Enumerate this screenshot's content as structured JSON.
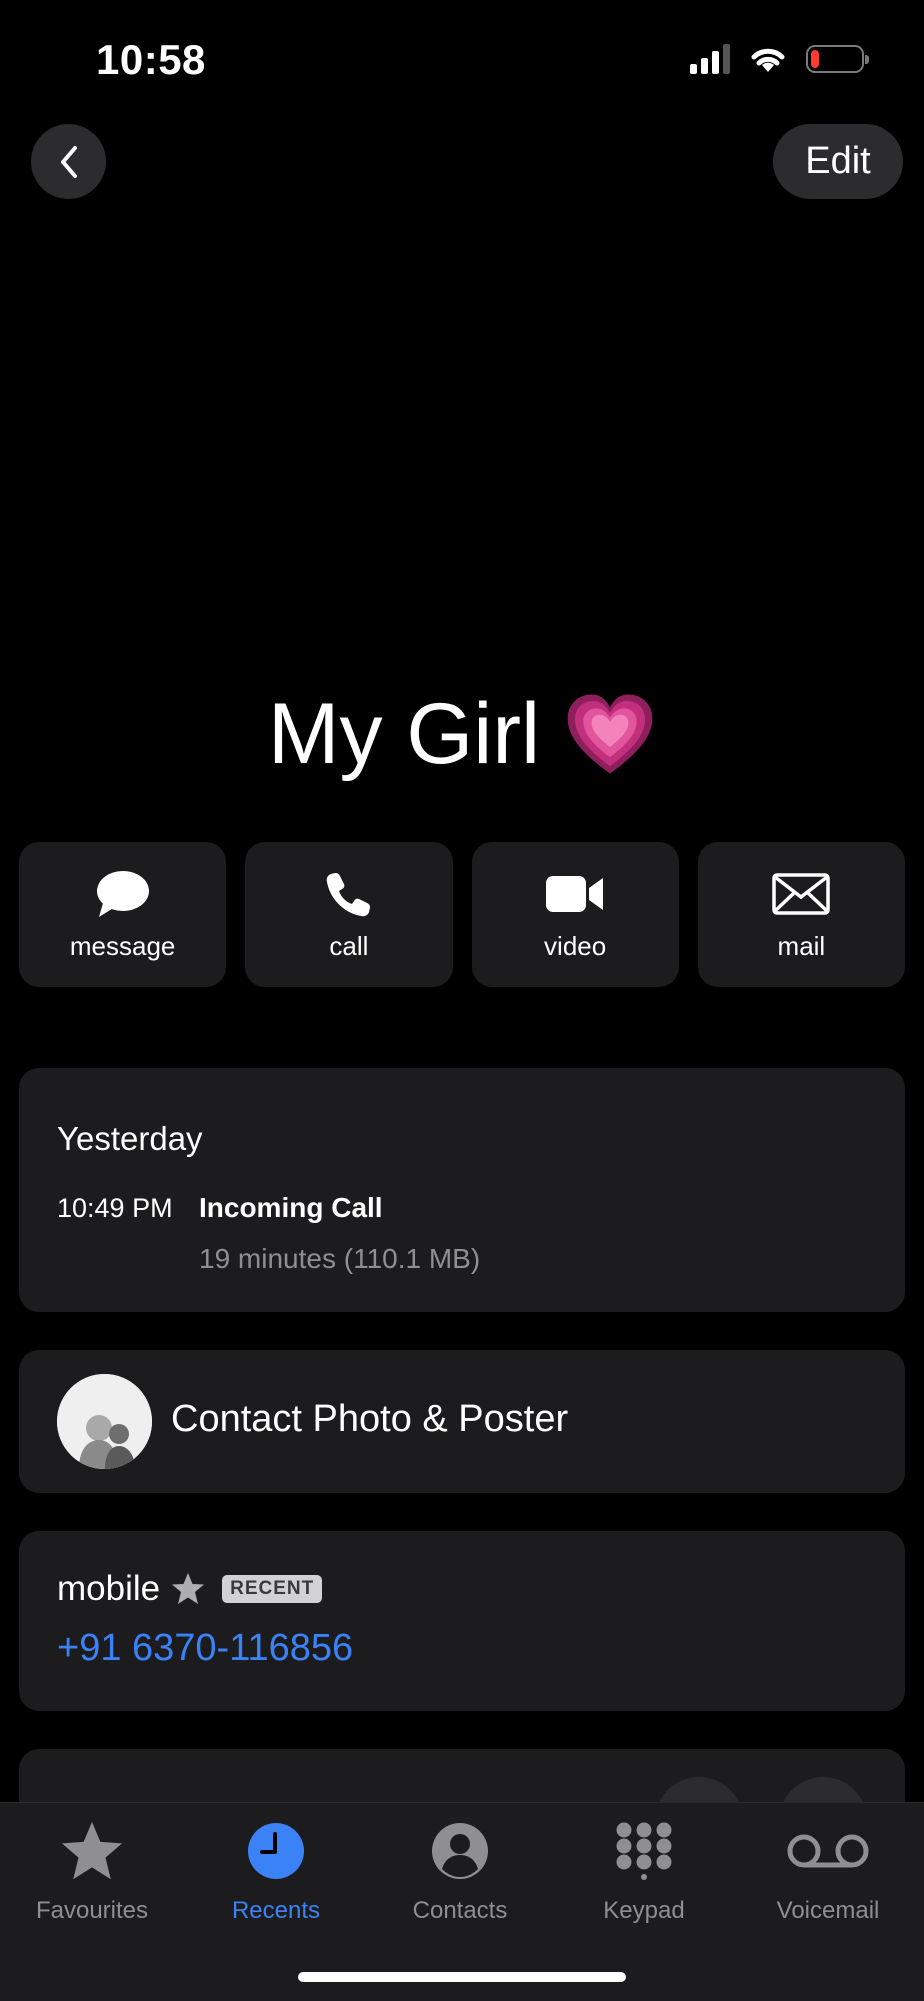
{
  "status_bar": {
    "time": "10:58",
    "battery_color": "#ff3b30"
  },
  "nav": {
    "back_icon": "chevron-left-icon",
    "edit_label": "Edit"
  },
  "contact": {
    "name": "My Girl",
    "emoji": "growing-heart-emoji"
  },
  "actions": [
    {
      "label": "message",
      "icon": "message-bubble-icon"
    },
    {
      "label": "call",
      "icon": "phone-icon"
    },
    {
      "label": "video",
      "icon": "video-camera-icon"
    },
    {
      "label": "mail",
      "icon": "envelope-icon"
    }
  ],
  "history": {
    "day": "Yesterday",
    "time": "10:49 PM",
    "type": "Incoming Call",
    "duration": "19 minutes (110.1 MB)"
  },
  "photo_poster": {
    "label": "Contact Photo & Poster"
  },
  "phone": {
    "type": "mobile",
    "badge": "RECENT",
    "number": "+91 6370-116856",
    "link_color": "#3b82f6"
  },
  "tabs": [
    {
      "label": "Favourites",
      "icon": "star-icon",
      "active": false
    },
    {
      "label": "Recents",
      "icon": "clock-icon",
      "active": true
    },
    {
      "label": "Contacts",
      "icon": "person-circle-icon",
      "active": false
    },
    {
      "label": "Keypad",
      "icon": "keypad-icon",
      "active": false
    },
    {
      "label": "Voicemail",
      "icon": "voicemail-icon",
      "active": false
    }
  ]
}
